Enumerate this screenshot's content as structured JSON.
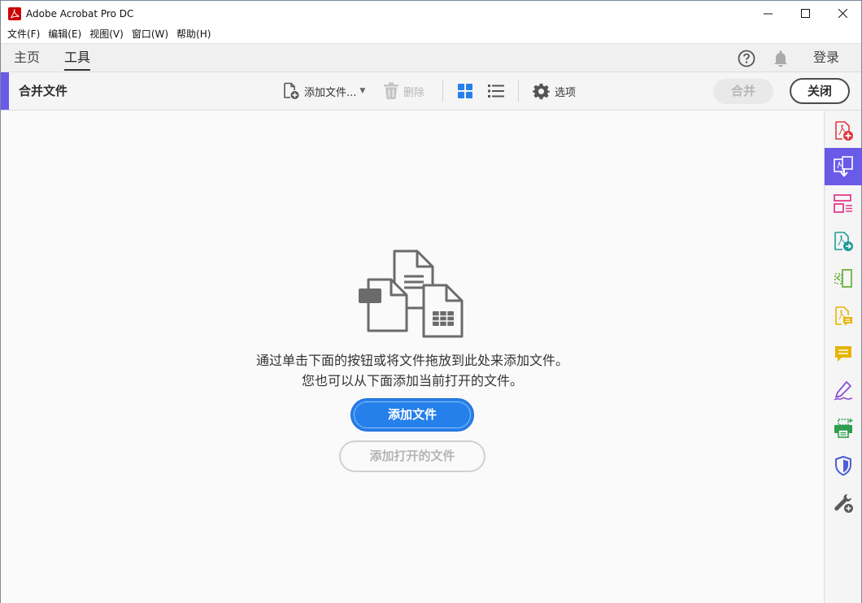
{
  "window": {
    "title": "Adobe Acrobat Pro DC",
    "controls": [
      "minimize-icon",
      "maximize-icon",
      "close-icon"
    ]
  },
  "menubar": {
    "items": [
      "文件(F)",
      "编辑(E)",
      "视图(V)",
      "窗口(W)",
      "帮助(H)"
    ]
  },
  "tabs": {
    "home": "主页",
    "tools": "工具",
    "active": "工具",
    "sign_in": "登录"
  },
  "toolbar": {
    "title": "合并文件",
    "add_files": "添加文件...",
    "delete": "删除",
    "options": "选项",
    "combine": "合并",
    "close": "关闭",
    "accent_color": "#6a5ae8"
  },
  "main": {
    "instruction_line1": "通过单击下面的按钮或将文件拖放到此处来添加文件。",
    "instruction_line2": "您也可以从下面添加当前打开的文件。",
    "add_files_button": "添加文件",
    "add_open_files_button": "添加打开的文件",
    "primary_color": "#2680eb"
  },
  "tool_rail": {
    "items": [
      {
        "icon": "create-pdf-icon",
        "color": "#e0383e"
      },
      {
        "icon": "combine-files-icon",
        "color": "#ffffff",
        "active": true
      },
      {
        "icon": "organize-pages-icon",
        "color": "#e23c8c"
      },
      {
        "icon": "export-pdf-icon",
        "color": "#1e9b95"
      },
      {
        "icon": "edit-pdf-icon",
        "color": "#6cb33f"
      },
      {
        "icon": "comment-file-icon",
        "color": "#e6b400"
      },
      {
        "icon": "comment-icon",
        "color": "#e6b400"
      },
      {
        "icon": "fill-sign-icon",
        "color": "#8b4fd1"
      },
      {
        "icon": "print-production-icon",
        "color": "#2e9e4f"
      },
      {
        "icon": "protect-icon",
        "color": "#4b5fd6"
      },
      {
        "icon": "more-tools-icon",
        "color": "#5a5a5a"
      }
    ]
  }
}
